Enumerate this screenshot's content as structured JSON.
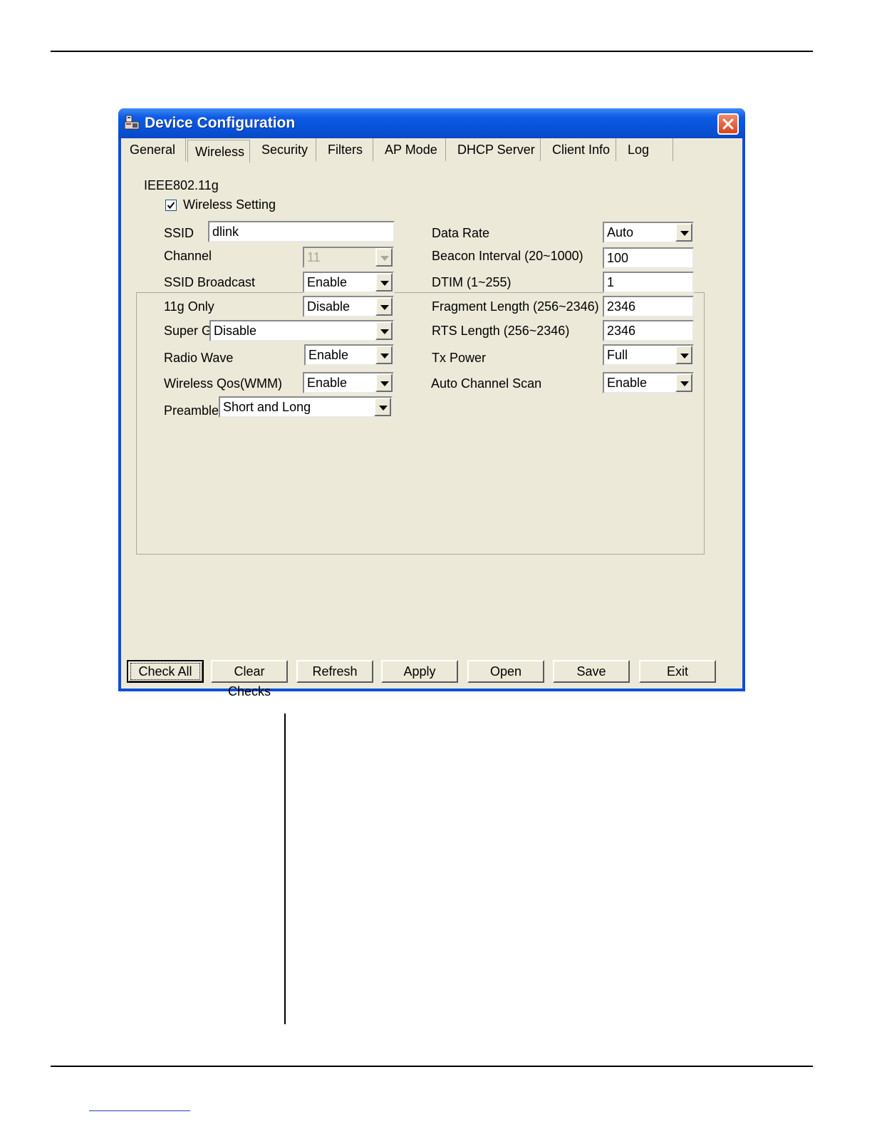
{
  "window": {
    "title": "Device Configuration"
  },
  "tabs": [
    {
      "label": "General"
    },
    {
      "label": "Wireless",
      "active": true
    },
    {
      "label": "Security"
    },
    {
      "label": "Filters"
    },
    {
      "label": "AP Mode"
    },
    {
      "label": "DHCP Server"
    },
    {
      "label": "Client Info"
    },
    {
      "label": "Log"
    }
  ],
  "group": {
    "title": "IEEE802.11g",
    "wireless_setting_label": "Wireless Setting",
    "wireless_setting_checked": true
  },
  "left": {
    "ssid_label": "SSID",
    "ssid_value": "dlink",
    "channel_label": "Channel",
    "channel_value": "11",
    "ssid_broadcast_label": "SSID Broadcast",
    "ssid_broadcast_value": "Enable",
    "only11g_label": "11g Only",
    "only11g_value": "Disable",
    "superg_label": "Super G",
    "superg_value": "Disable",
    "radio_wave_label": "Radio Wave",
    "radio_wave_value": "Enable",
    "qos_label": "Wireless Qos(WMM)",
    "qos_value": "Enable",
    "preamble_label": "Preamble",
    "preamble_value": "Short and Long"
  },
  "right": {
    "data_rate_label": "Data Rate",
    "data_rate_value": "Auto",
    "beacon_label": "Beacon Interval (20~1000)",
    "beacon_value": "100",
    "dtim_label": "DTIM (1~255)",
    "dtim_value": "1",
    "fragment_label": "Fragment Length (256~2346)",
    "fragment_value": "2346",
    "rts_label": "RTS Length (256~2346)",
    "rts_value": "2346",
    "tx_power_label": "Tx Power",
    "tx_power_value": "Full",
    "auto_channel_label": "Auto Channel Scan",
    "auto_channel_value": "Enable"
  },
  "buttons": {
    "check_all": "Check All",
    "clear_checks": "Clear Checks",
    "refresh": "Refresh",
    "apply": "Apply",
    "open": "Open",
    "save": "Save",
    "exit": "Exit"
  }
}
